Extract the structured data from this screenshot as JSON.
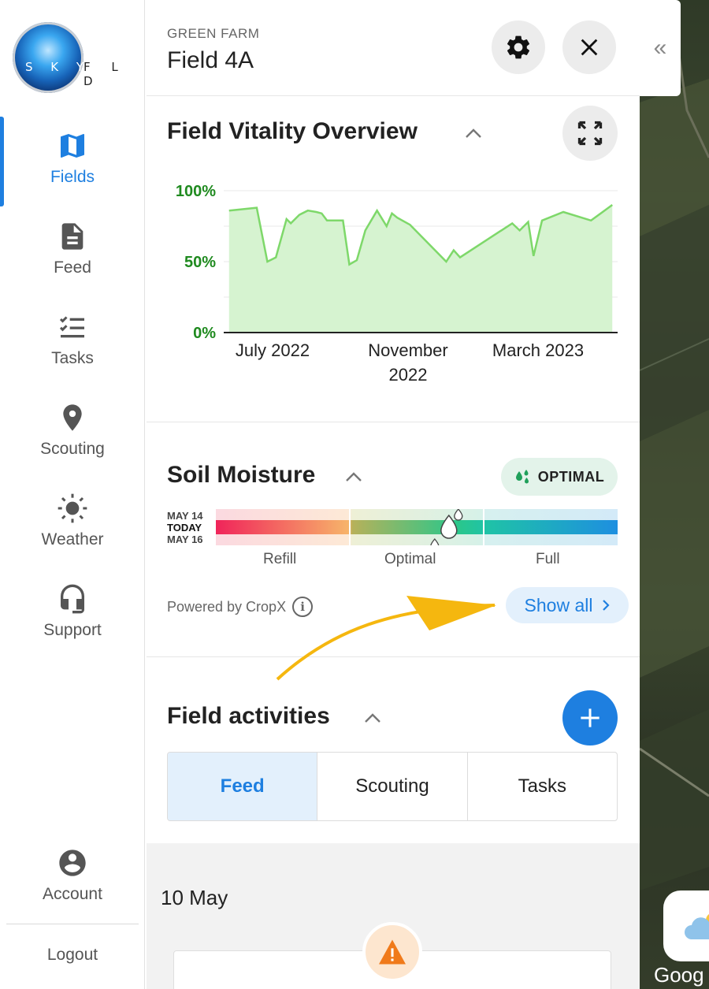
{
  "brand": {
    "logo_left": "S K Y",
    "logo_right": "F L D"
  },
  "sidebar": {
    "items": [
      {
        "label": "Fields",
        "icon": "map-icon",
        "active": true
      },
      {
        "label": "Feed",
        "icon": "document-icon",
        "active": false
      },
      {
        "label": "Tasks",
        "icon": "checklist-icon",
        "active": false
      },
      {
        "label": "Scouting",
        "icon": "location-pin-icon",
        "active": false
      },
      {
        "label": "Weather",
        "icon": "sun-icon",
        "active": false
      },
      {
        "label": "Support",
        "icon": "headset-icon",
        "active": false
      }
    ],
    "account_label": "Account",
    "logout_label": "Logout"
  },
  "header": {
    "farm": "GREEN FARM",
    "field": "Field 4A"
  },
  "vitality": {
    "title": "Field Vitality Overview",
    "chart_data": {
      "type": "area",
      "y_ticks": [
        "100%",
        "50%",
        "0%"
      ],
      "x_ticks": [
        "July 2022",
        "November 2022",
        "March 2023"
      ],
      "x": [
        "2022-05-15",
        "2022-06-10",
        "2022-06-20",
        "2022-06-28",
        "2022-07-08",
        "2022-07-12",
        "2022-07-20",
        "2022-07-28",
        "2022-08-05",
        "2022-08-10",
        "2022-08-15",
        "2022-08-30",
        "2022-09-05",
        "2022-09-12",
        "2022-09-20",
        "2022-10-01",
        "2022-10-10",
        "2022-10-15",
        "2022-10-20",
        "2022-11-01",
        "2022-12-05",
        "2022-12-12",
        "2022-12-18",
        "2023-02-05",
        "2023-02-12",
        "2023-02-20",
        "2023-02-25",
        "2023-03-05",
        "2023-03-25",
        "2023-04-20",
        "2023-05-10"
      ],
      "values": [
        86,
        88,
        50,
        53,
        80,
        77,
        83,
        86,
        85,
        84,
        79,
        79,
        48,
        51,
        72,
        86,
        75,
        84,
        81,
        76,
        50,
        58,
        53,
        77,
        72,
        78,
        54,
        79,
        85,
        79,
        90
      ],
      "ylim": [
        0,
        100
      ],
      "colors": {
        "line": "#7ed86a",
        "fill": "#d6f3d0",
        "ticks_y": "#1f8a1f"
      }
    }
  },
  "soil": {
    "title": "Soil Moisture",
    "status": "OPTIMAL",
    "status_icon": "water-drops-icon",
    "dates": [
      "MAY 14",
      "TODAY",
      "MAY 16"
    ],
    "zones": [
      "Refill",
      "Optimal",
      "Full"
    ],
    "level": 0.58,
    "powered_by": "Powered by CropX",
    "show_all": "Show all"
  },
  "activities": {
    "title": "Field activities",
    "tabs": [
      {
        "label": "Feed",
        "active": true
      },
      {
        "label": "Scouting",
        "active": false
      },
      {
        "label": "Tasks",
        "active": false
      }
    ]
  },
  "feed": {
    "date": "10 May"
  },
  "map": {
    "collapse_label": "«",
    "attribution": "Goog"
  },
  "colors": {
    "accent": "#1e7fe0",
    "optimal_badge": "#e3f3ea",
    "annotation_arrow": "#f5b70f"
  }
}
